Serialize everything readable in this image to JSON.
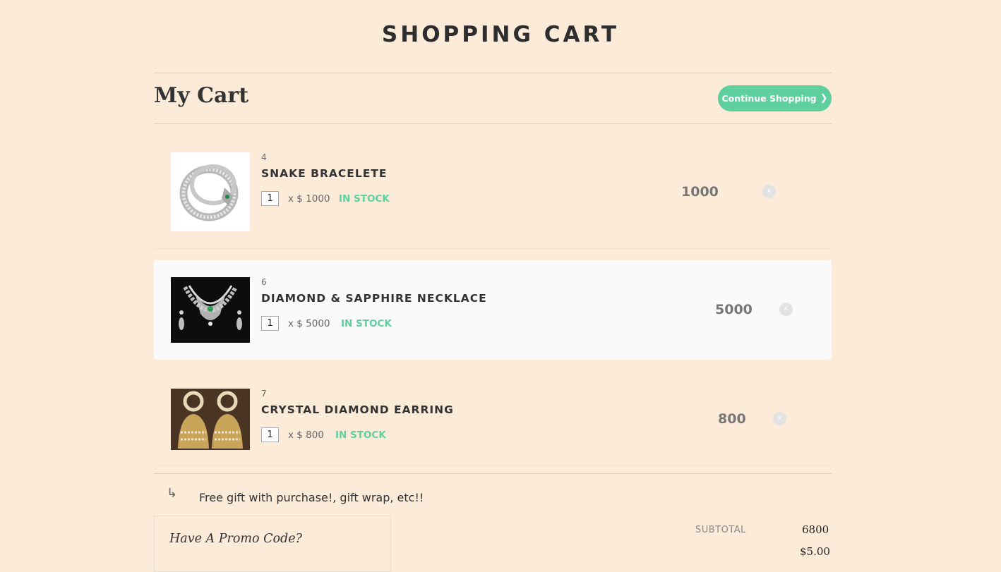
{
  "page": {
    "title": "SHOPPING CART"
  },
  "header": {
    "heading": "My Cart",
    "continue_label": "Continue Shopping",
    "continue_icon": "chevron-right-icon"
  },
  "items": [
    {
      "id": "4",
      "name": "SNAKE BRACELETE",
      "qty": "1",
      "unit_price": "x $ 1000",
      "stock": "IN STOCK",
      "total": "1000",
      "remove": "x"
    },
    {
      "id": "6",
      "name": "DIAMOND & SAPPHIRE NECKLACE",
      "qty": "1",
      "unit_price": "x $ 5000",
      "stock": "IN STOCK",
      "total": "5000",
      "remove": "x"
    },
    {
      "id": "7",
      "name": "CRYSTAL DIAMOND EARRING",
      "qty": "1",
      "unit_price": "x $ 800",
      "stock": "IN STOCK",
      "total": "800",
      "remove": "x"
    }
  ],
  "gift": {
    "text": "Free gift with purchase!, gift wrap, etc!!",
    "icon": "return-arrow-icon"
  },
  "promo": {
    "title": "Have A Promo Code?"
  },
  "summary": {
    "subtotal_label": "SUBTOTAL",
    "subtotal_value": "6800",
    "next_value_partial": "$5.00"
  },
  "colors": {
    "background": "#fcebd8",
    "accent": "#5fcf9e",
    "highlight_row": "#fafafa"
  }
}
